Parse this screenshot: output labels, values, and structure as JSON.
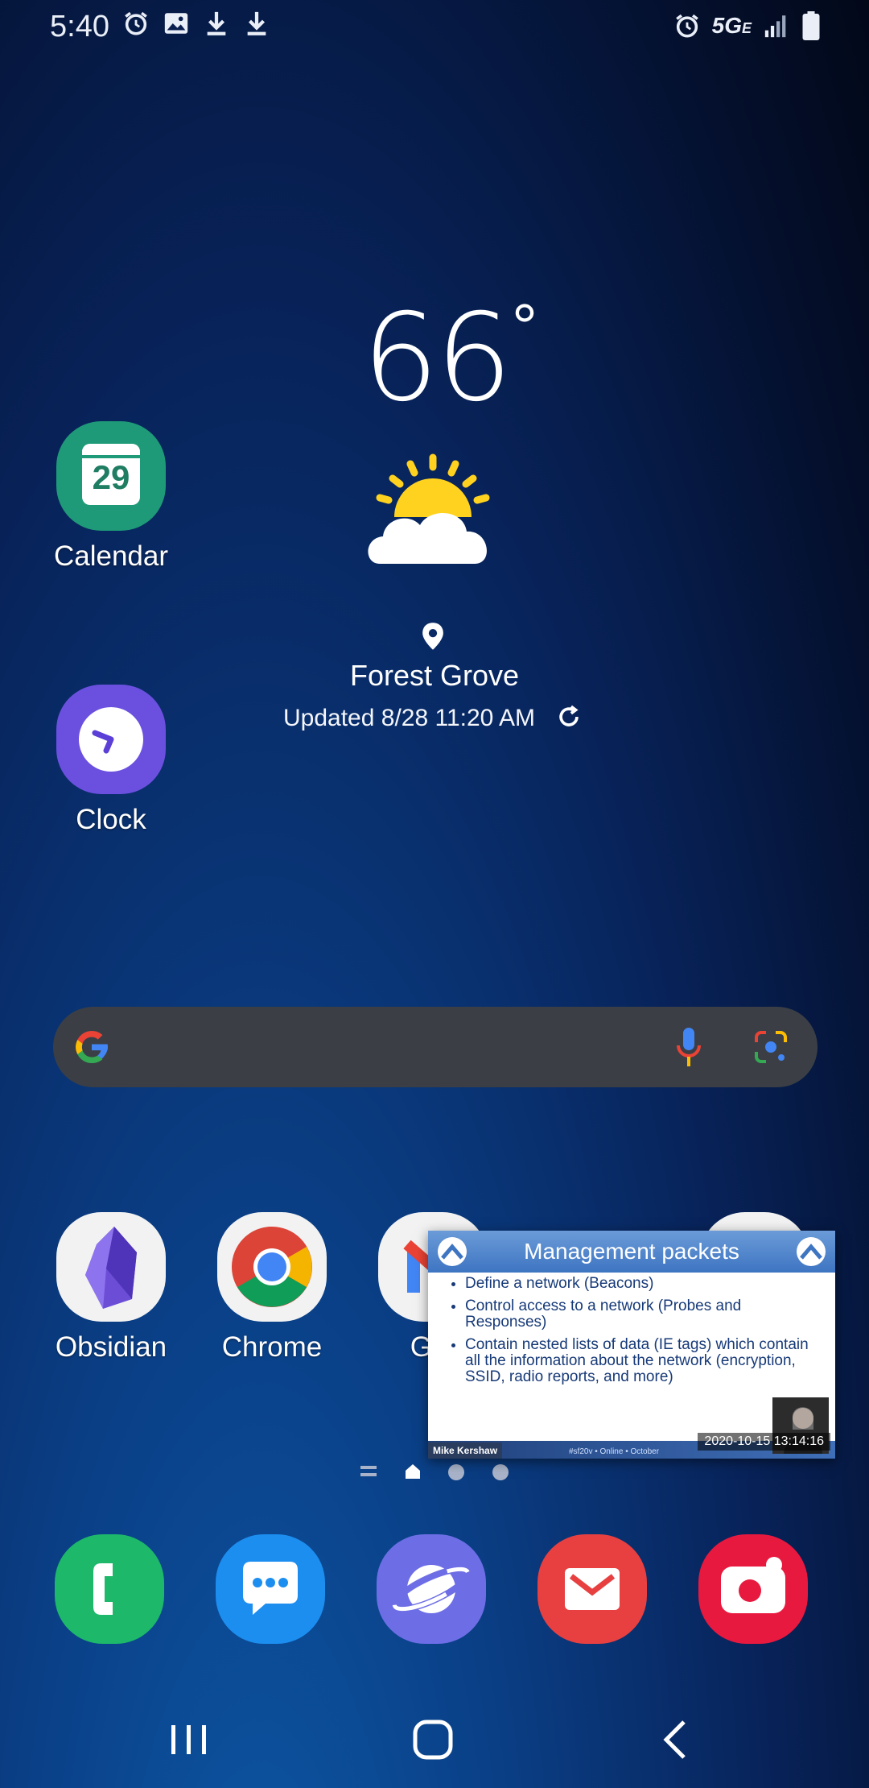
{
  "status_bar": {
    "time": "5:40",
    "left_icons": [
      "alarm-icon",
      "image-icon",
      "download-icon",
      "download-icon"
    ],
    "network": "5G",
    "network_sub": "E",
    "right_icons": [
      "alarm-icon",
      "signal-icon",
      "battery-icon"
    ]
  },
  "weather": {
    "temperature": "66",
    "degree_symbol": "°",
    "condition_icon": "partly-sunny-icon",
    "location": "Forest Grove",
    "updated": "Updated 8/28 11:20 AM"
  },
  "apps": {
    "calendar": {
      "label": "Calendar",
      "day": "29"
    },
    "clock": {
      "label": "Clock"
    },
    "obsidian": {
      "label": "Obsidian"
    },
    "chrome": {
      "label": "Chrome"
    },
    "gmail": {
      "label": "Gm"
    }
  },
  "search": {
    "icons": [
      "google-g-icon",
      "microphone-icon",
      "google-lens-icon"
    ]
  },
  "pip_video": {
    "title": "Management packets",
    "bullets": [
      "Define a network (Beacons)",
      "Control access to a network (Probes and Responses)",
      "Contain nested lists of data (IE tags) which contain all the information about the network (encryption, SSID, radio reports, and more)"
    ],
    "presenter": "Mike Kershaw",
    "footer_tags": "#sf20v  •  Online  •  October",
    "timestamp": "2020-10-15  13:14:16"
  },
  "dock": [
    "phone",
    "messages",
    "internet",
    "email",
    "camera"
  ],
  "colors": {
    "calendar": "#1f9a78",
    "clock": "#6b50e0",
    "phone": "#1db86a",
    "messages": "#1c8ef0",
    "internet": "#6d6ee6",
    "email": "#e84040",
    "camera": "#e8193f",
    "search_bar": "#3b3f45"
  }
}
